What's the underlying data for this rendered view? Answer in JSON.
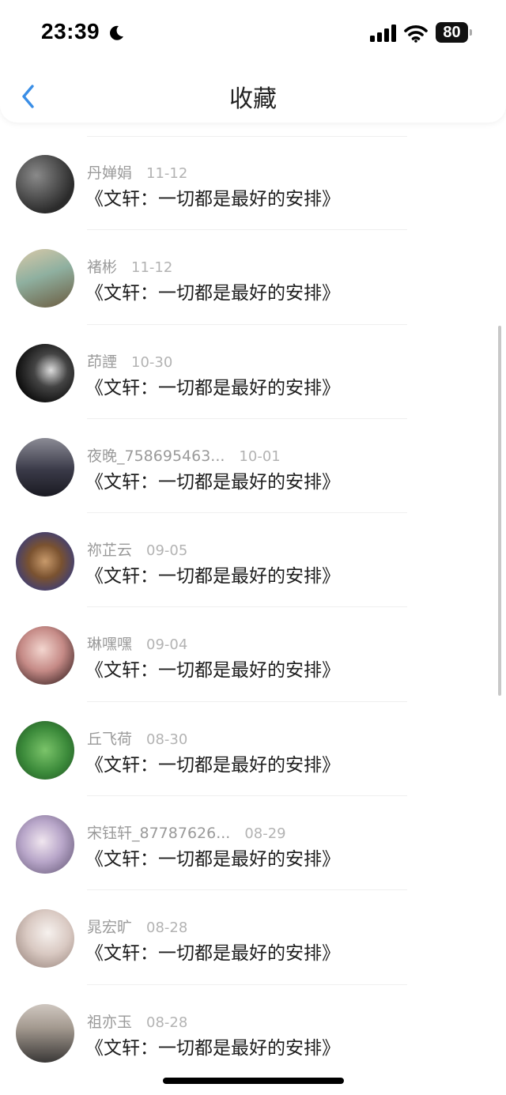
{
  "status_bar": {
    "time": "23:39",
    "battery": "80",
    "icons": [
      "moon-icon",
      "signal-icon",
      "wifi-icon",
      "battery-icon"
    ]
  },
  "nav": {
    "title": "收藏",
    "back_icon": "chevron-left-icon",
    "accent_color": "#3a8ee6"
  },
  "favorites": [
    {
      "name": "丹婵娟",
      "date": "11-12",
      "title": "《文轩：一切都是最好的安排》"
    },
    {
      "name": "褚彬",
      "date": "11-12",
      "title": "《文轩：一切都是最好的安排》"
    },
    {
      "name": "茚諲",
      "date": "10-30",
      "title": "《文轩：一切都是最好的安排》"
    },
    {
      "name": "夜晚_758695463...",
      "date": "10-01",
      "title": "《文轩：一切都是最好的安排》"
    },
    {
      "name": "祢芷云",
      "date": "09-05",
      "title": "《文轩：一切都是最好的安排》"
    },
    {
      "name": "琳嘿嘿",
      "date": "09-04",
      "title": "《文轩：一切都是最好的安排》"
    },
    {
      "name": "丘飞荷",
      "date": "08-30",
      "title": "《文轩：一切都是最好的安排》"
    },
    {
      "name": "宋钰轩_87787626...",
      "date": "08-29",
      "title": "《文轩：一切都是最好的安排》"
    },
    {
      "name": "晁宏旷",
      "date": "08-28",
      "title": "《文轩：一切都是最好的安排》"
    },
    {
      "name": "祖亦玉",
      "date": "08-28",
      "title": "《文轩：一切都是最好的安排》"
    }
  ]
}
